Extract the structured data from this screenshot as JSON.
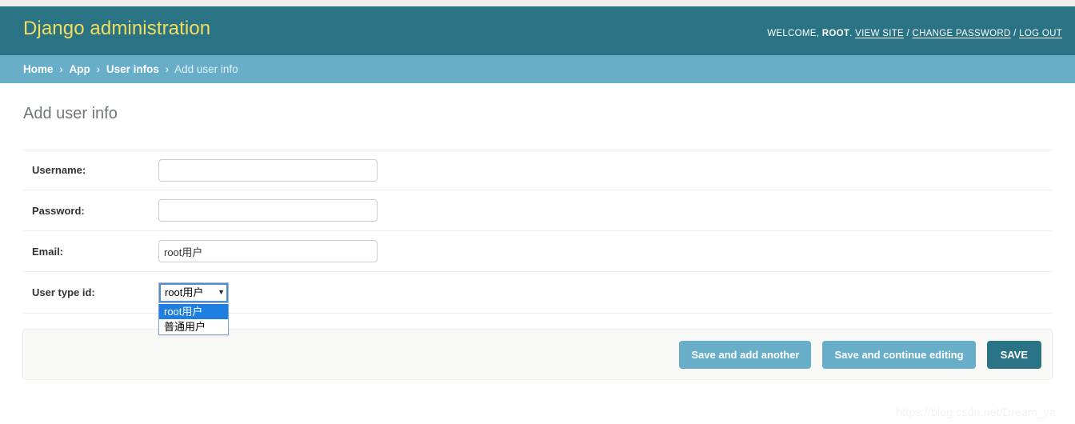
{
  "header": {
    "branding_title": "Django administration",
    "user_tools": {
      "welcome_prefix": "WELCOME,",
      "username": "ROOT",
      "period": ".",
      "view_site": "VIEW SITE",
      "separator": "/",
      "change_password": "CHANGE PASSWORD",
      "log_out": "LOG OUT"
    },
    "colors": {
      "header_bg": "#2a7384",
      "branding_color": "#f5dd5d",
      "breadcrumb_bg": "#68aec8"
    }
  },
  "breadcrumbs": {
    "separator": "›",
    "items": [
      {
        "label": "Home",
        "current": false
      },
      {
        "label": "App",
        "current": false
      },
      {
        "label": "User infos",
        "current": false
      },
      {
        "label": "Add user info",
        "current": true
      }
    ]
  },
  "main": {
    "page_title": "Add user info",
    "form_rows": [
      {
        "label": "Username:",
        "type": "text",
        "value": "",
        "placeholder": ""
      },
      {
        "label": "Password:",
        "type": "text",
        "value": "",
        "placeholder": ""
      },
      {
        "label": "Email:",
        "type": "text",
        "value": "",
        "placeholder": ""
      },
      {
        "label": "User type id:",
        "type": "select",
        "value": "root用户",
        "placeholder": ""
      }
    ],
    "select": {
      "label": "User type id:",
      "selected_value": "root用户",
      "arrow_icon": "▼",
      "open": true,
      "options": [
        {
          "label": "root用户",
          "selected": true
        },
        {
          "label": "普通用户",
          "selected": false
        }
      ],
      "highlight_color": "#1e7fe0"
    }
  },
  "submit_row": {
    "save_and_add_another": "Save and add another",
    "save_and_continue_editing": "Save and continue editing",
    "save": "SAVE",
    "colors": {
      "default_button": "#68aec8",
      "primary_button": "#2a7384",
      "row_bg": "#f8f8f6"
    }
  },
  "watermark": {
    "text": "https://blog.csdn.net/Dream_ya"
  }
}
